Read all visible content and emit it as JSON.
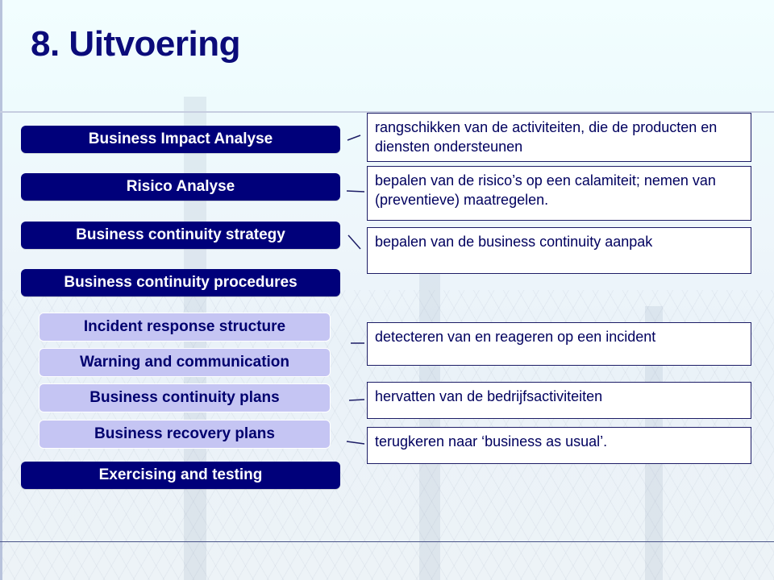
{
  "slide": {
    "title": "8. Uitvoering"
  },
  "phases": [
    {
      "label": "Business Impact Analyse",
      "level": "main"
    },
    {
      "label": "Risico Analyse",
      "level": "main"
    },
    {
      "label": "Business continuity strategy",
      "level": "main"
    },
    {
      "label": "Business continuity procedures",
      "level": "main"
    },
    {
      "label": "Incident response structure",
      "level": "sub"
    },
    {
      "label": "Warning and communication",
      "level": "sub"
    },
    {
      "label": "Business continuity plans",
      "level": "sub"
    },
    {
      "label": "Business recovery plans",
      "level": "sub"
    },
    {
      "label": "Exercising and testing",
      "level": "main"
    }
  ],
  "descriptions": [
    {
      "text": "rangschikken van de activiteiten, die de producten en diensten ondersteunen",
      "linked_phase": "Business Impact Analyse"
    },
    {
      "text": "bepalen van de risico’s op een calamiteit; nemen van (preventieve) maatregelen.",
      "linked_phase": "Risico Analyse"
    },
    {
      "text": "bepalen van de business continuity aanpak",
      "linked_phase": "Business continuity strategy"
    },
    {
      "text": "detecteren van en reageren op een incident",
      "linked_phase": "Incident response structure"
    },
    {
      "text": "hervatten van de bedrijfsactiviteiten",
      "linked_phase": "Business continuity plans"
    },
    {
      "text": "terugkeren naar ‘business as usual’.",
      "linked_phase": "Business recovery plans"
    }
  ],
  "colors": {
    "title": "#0b0b7a",
    "main_phase_bg": "#00007a",
    "main_phase_text": "#ffffff",
    "sub_phase_bg": "#c5c5f3",
    "sub_phase_text": "#00006e",
    "description_border": "#1d1d66",
    "description_text": "#00005e"
  }
}
